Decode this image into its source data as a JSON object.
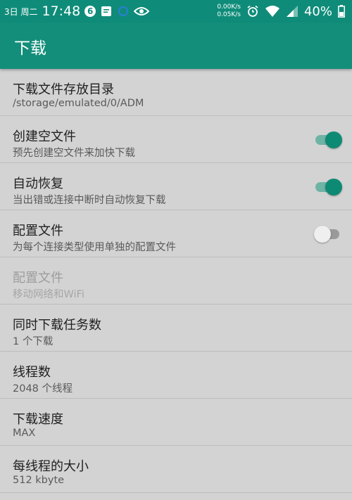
{
  "status_bar": {
    "date": "3日 周二",
    "time": "17:48",
    "notification_count": "6",
    "net_speed_up": "0.00K/s",
    "net_speed_down": "0.05K/s",
    "battery": "40%",
    "icons": [
      "notification-badge-icon",
      "message-icon",
      "sync-icon",
      "eye-icon",
      "alarm-icon",
      "wifi-icon",
      "signal-icon",
      "battery-icon"
    ]
  },
  "app_bar": {
    "title": "下载"
  },
  "settings": [
    {
      "title": "下载文件存放目录",
      "subtitle": "/storage/emulated/0/ADM"
    },
    {
      "title": "创建空文件",
      "subtitle": "预先创建空文件来加快下载",
      "toggle": true
    },
    {
      "title": "自动恢复",
      "subtitle": "当出错或连接中断时自动恢复下载",
      "toggle": true
    },
    {
      "title": "配置文件",
      "subtitle": "为每个连接类型使用单独的配置文件",
      "toggle": false
    },
    {
      "title": "配置文件",
      "subtitle": "移动网络和WiFi",
      "disabled": true
    },
    {
      "title": "同时下载任务数",
      "subtitle": "1 个下载"
    },
    {
      "title": "线程数",
      "subtitle": "2048 个线程"
    },
    {
      "title": "下载速度",
      "subtitle": "MAX"
    },
    {
      "title": "每线程的大小",
      "subtitle": "512 kbyte"
    }
  ],
  "colors": {
    "primary": "#138e7a",
    "toggle_on": "#0d8a73",
    "background": "#d3d3d3"
  }
}
